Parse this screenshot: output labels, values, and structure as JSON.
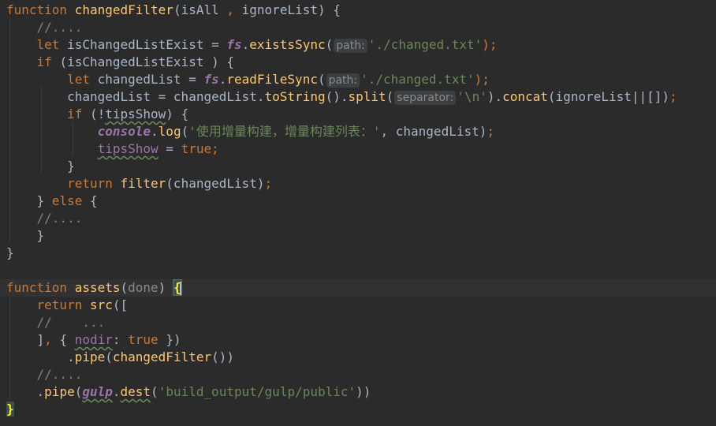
{
  "editor": {
    "lines": [
      {
        "tokens": [
          {
            "t": "function ",
            "c": "kw"
          },
          {
            "t": "changedFilter",
            "c": "fn"
          },
          {
            "t": "(isAll ",
            "c": ""
          },
          {
            "t": ",",
            "c": "punct"
          },
          {
            "t": " ignoreList) {",
            "c": ""
          }
        ]
      },
      {
        "tokens": [
          {
            "t": "    ",
            "c": ""
          },
          {
            "t": "//....",
            "c": "cm"
          }
        ]
      },
      {
        "tokens": [
          {
            "t": "    ",
            "c": ""
          },
          {
            "t": "let ",
            "c": "kw"
          },
          {
            "t": "isChangedListExist = ",
            "c": ""
          },
          {
            "t": "fs",
            "c": "gl"
          },
          {
            "t": ".",
            "c": ""
          },
          {
            "t": "existsSync",
            "c": "fn"
          },
          {
            "t": "(",
            "c": ""
          },
          {
            "hint": "path:"
          },
          {
            "t": "'./changed.txt'",
            "c": "str"
          },
          {
            "t": ");",
            "c": "punct"
          }
        ]
      },
      {
        "tokens": [
          {
            "t": "    ",
            "c": ""
          },
          {
            "t": "if ",
            "c": "kw"
          },
          {
            "t": "(isChangedListExist ) {",
            "c": ""
          }
        ]
      },
      {
        "tokens": [
          {
            "t": "        ",
            "c": ""
          },
          {
            "t": "let ",
            "c": "kw"
          },
          {
            "t": "changedList = ",
            "c": ""
          },
          {
            "t": "fs",
            "c": "gl"
          },
          {
            "t": ".",
            "c": ""
          },
          {
            "t": "readFileSync",
            "c": "fn"
          },
          {
            "t": "(",
            "c": ""
          },
          {
            "hint": "path:"
          },
          {
            "t": "'./changed.txt'",
            "c": "str"
          },
          {
            "t": ");",
            "c": "punct"
          }
        ]
      },
      {
        "tokens": [
          {
            "t": "        ",
            "c": ""
          },
          {
            "t": "changedList = changedList.",
            "c": ""
          },
          {
            "t": "toString",
            "c": "fn"
          },
          {
            "t": "().",
            "c": ""
          },
          {
            "t": "split",
            "c": "fn"
          },
          {
            "t": "(",
            "c": ""
          },
          {
            "hint": "separator:"
          },
          {
            "t": "'\\n'",
            "c": "str"
          },
          {
            "t": ").",
            "c": ""
          },
          {
            "t": "concat",
            "c": "fn"
          },
          {
            "t": "(ignoreList||[])",
            "c": ""
          },
          {
            "t": ";",
            "c": "punct"
          }
        ]
      },
      {
        "tokens": [
          {
            "t": "        ",
            "c": ""
          },
          {
            "t": "if ",
            "c": "kw"
          },
          {
            "t": "(!",
            "c": ""
          },
          {
            "t": "tipsShow",
            "c": "squig"
          },
          {
            "t": ") {",
            "c": ""
          }
        ]
      },
      {
        "tokens": [
          {
            "t": "            ",
            "c": ""
          },
          {
            "t": "console",
            "c": "gl"
          },
          {
            "t": ".",
            "c": ""
          },
          {
            "t": "log",
            "c": "fn"
          },
          {
            "t": "(",
            "c": ""
          },
          {
            "t": "'使用增量构建，增量构建列表：'",
            "c": "str"
          },
          {
            "t": ", changedList)",
            "c": ""
          },
          {
            "t": ";",
            "c": "punct"
          }
        ]
      },
      {
        "tokens": [
          {
            "t": "            ",
            "c": ""
          },
          {
            "t": "tipsShow",
            "c": "prop squig"
          },
          {
            "t": " = ",
            "c": ""
          },
          {
            "t": "true",
            "c": "kw"
          },
          {
            "t": ";",
            "c": "punct"
          }
        ]
      },
      {
        "tokens": [
          {
            "t": "        }",
            "c": ""
          }
        ]
      },
      {
        "tokens": [
          {
            "t": "        ",
            "c": ""
          },
          {
            "t": "return ",
            "c": "kw"
          },
          {
            "t": "filter",
            "c": "fn"
          },
          {
            "t": "(changedList)",
            "c": ""
          },
          {
            "t": ";",
            "c": "punct"
          }
        ]
      },
      {
        "tokens": [
          {
            "t": "    } ",
            "c": ""
          },
          {
            "t": "else ",
            "c": "kw"
          },
          {
            "t": "{",
            "c": ""
          }
        ]
      },
      {
        "tokens": [
          {
            "t": "    ",
            "c": ""
          },
          {
            "t": "//....",
            "c": "cm"
          }
        ]
      },
      {
        "tokens": [
          {
            "t": "    }",
            "c": ""
          }
        ]
      },
      {
        "tokens": [
          {
            "t": "}",
            "c": ""
          }
        ]
      },
      {
        "tokens": []
      },
      {
        "current": true,
        "tokens": [
          {
            "t": "function ",
            "c": "kw"
          },
          {
            "t": "assets",
            "c": "fn"
          },
          {
            "t": "(",
            "c": ""
          },
          {
            "t": "done",
            "c": "param-dim"
          },
          {
            "t": ") ",
            "c": ""
          },
          {
            "t": "{",
            "c": "brace-match"
          },
          {
            "caret": true
          }
        ]
      },
      {
        "tokens": [
          {
            "t": "    ",
            "c": ""
          },
          {
            "t": "return ",
            "c": "kw"
          },
          {
            "t": "src",
            "c": "fn"
          },
          {
            "t": "([",
            "c": ""
          }
        ]
      },
      {
        "tokens": [
          {
            "t": "    ",
            "c": ""
          },
          {
            "t": "//    ...",
            "c": "cm"
          }
        ]
      },
      {
        "tokens": [
          {
            "t": "    ]",
            "c": ""
          },
          {
            "t": ",",
            "c": "punct"
          },
          {
            "t": " { ",
            "c": ""
          },
          {
            "t": "nodir",
            "c": "prop squig"
          },
          {
            "t": ": ",
            "c": ""
          },
          {
            "t": "true",
            "c": "kw"
          },
          {
            "t": " })",
            "c": ""
          }
        ]
      },
      {
        "tokens": [
          {
            "t": "        .",
            "c": ""
          },
          {
            "t": "pipe",
            "c": "fn"
          },
          {
            "t": "(",
            "c": ""
          },
          {
            "t": "changedFilter",
            "c": "fn"
          },
          {
            "t": "())",
            "c": ""
          }
        ]
      },
      {
        "tokens": [
          {
            "t": "    ",
            "c": ""
          },
          {
            "t": "//....",
            "c": "cm"
          }
        ]
      },
      {
        "tokens": [
          {
            "t": "    .",
            "c": ""
          },
          {
            "t": "pipe",
            "c": "fn"
          },
          {
            "t": "(",
            "c": ""
          },
          {
            "t": "gulp",
            "c": "gl squig"
          },
          {
            "t": ".",
            "c": ""
          },
          {
            "t": "dest",
            "c": "fn squig"
          },
          {
            "t": "(",
            "c": ""
          },
          {
            "t": "'build_output/gulp/public'",
            "c": "str"
          },
          {
            "t": "))",
            "c": ""
          }
        ]
      },
      {
        "tokens": [
          {
            "t": "}",
            "c": "brace-match2"
          }
        ]
      }
    ]
  }
}
